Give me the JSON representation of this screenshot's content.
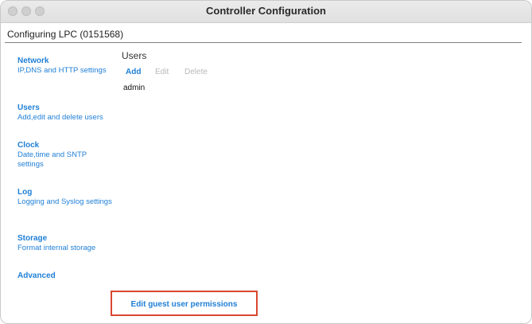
{
  "window": {
    "title": "Controller Configuration"
  },
  "header": {
    "subtitle": "Configuring LPC (0151568)"
  },
  "sidebar": {
    "items": [
      {
        "title": "Network",
        "desc": "IP,DNS and HTTP settings"
      },
      {
        "title": "Users",
        "desc": "Add,edit and delete users"
      },
      {
        "title": "Clock",
        "desc": "Date,time and SNTP settings"
      },
      {
        "title": "Log",
        "desc": "Logging and Syslog settings"
      },
      {
        "title": "Storage",
        "desc": "Format internal storage"
      },
      {
        "title": "Advanced",
        "desc": ""
      }
    ]
  },
  "main": {
    "heading": "Users",
    "actions": {
      "add": "Add",
      "edit": "Edit",
      "delete": "Delete"
    },
    "users": [
      "admin"
    ],
    "guest_permissions_link": "Edit guest user permissions"
  },
  "colors": {
    "link": "#1f7fd6",
    "disabled": "#b8b8b8",
    "highlight_border": "#d9472f"
  }
}
